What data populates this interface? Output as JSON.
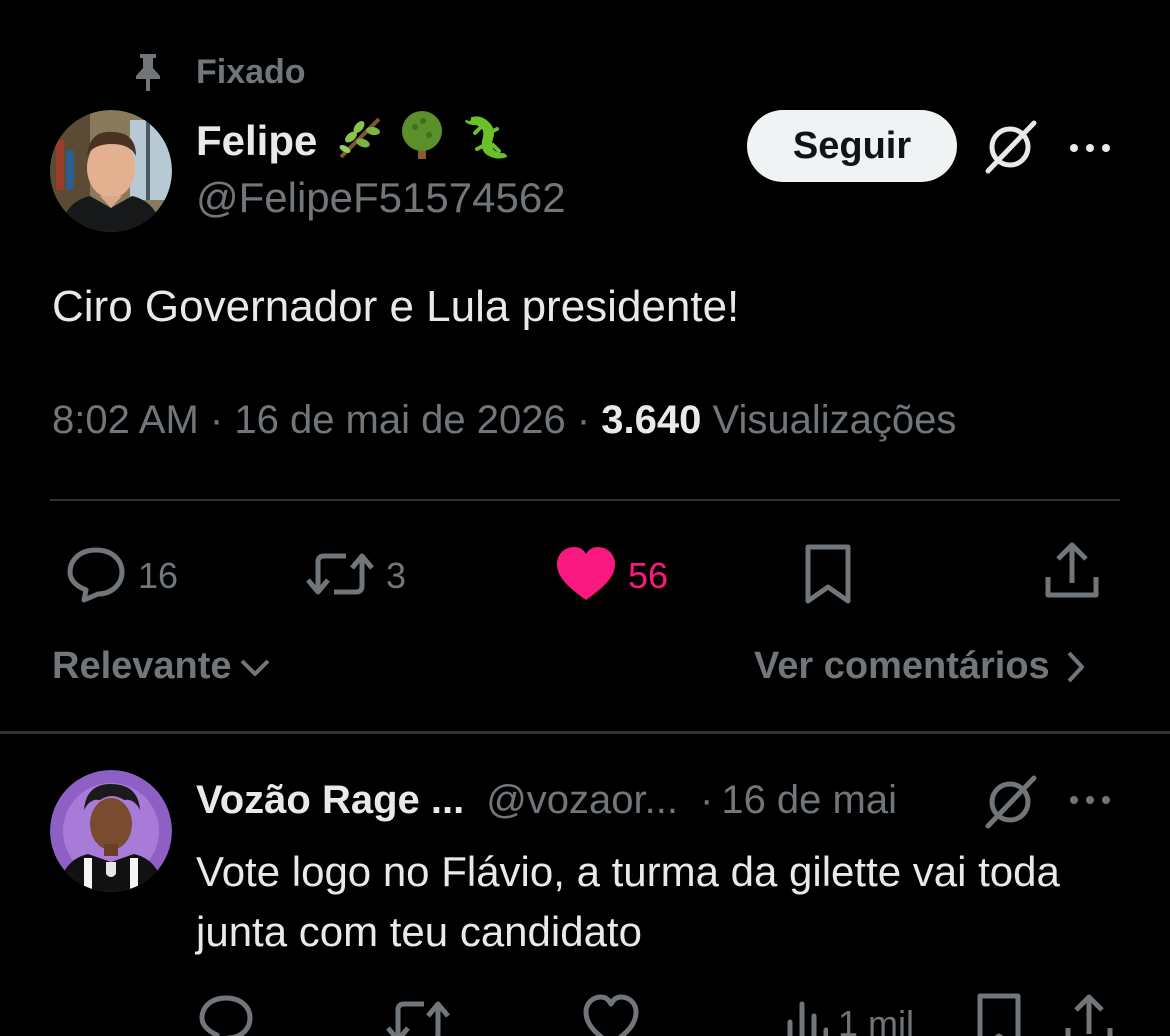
{
  "pinned": {
    "label": "Fixado",
    "icon": "pin-icon"
  },
  "author": {
    "name": "Felipe",
    "emojis": [
      "herb-emoji",
      "tree-emoji",
      "lizard-emoji"
    ],
    "handle": "@FelipeF51574562",
    "avatar": "avatar"
  },
  "follow_button": {
    "label": "Seguir"
  },
  "tweet": {
    "text": "Ciro Governador e Lula presidente!",
    "time": "8:02 AM",
    "date": "16 de mai de 2026",
    "views_count": "3.640",
    "views_label": "Visualizações",
    "separator": "·"
  },
  "actions": {
    "replies": "16",
    "reposts": "3",
    "likes": "56",
    "like_color": "#f91880"
  },
  "sort": {
    "label": "Relevante"
  },
  "view_comments": {
    "label": "Ver comentários"
  },
  "reply": {
    "name": "Vozão Rage ...",
    "handle": "@vozaor...",
    "separator": "·",
    "time": "16 de mai",
    "text": "Vote logo no Flávio, a turma da gilette vai toda junta com teu candidato",
    "views": "1 mil"
  },
  "colors": {
    "background": "#000000",
    "primary_text": "#e7e9ea",
    "secondary_text": "#71767b",
    "divider": "#2f3336",
    "follow_bg": "#eff3f4"
  }
}
